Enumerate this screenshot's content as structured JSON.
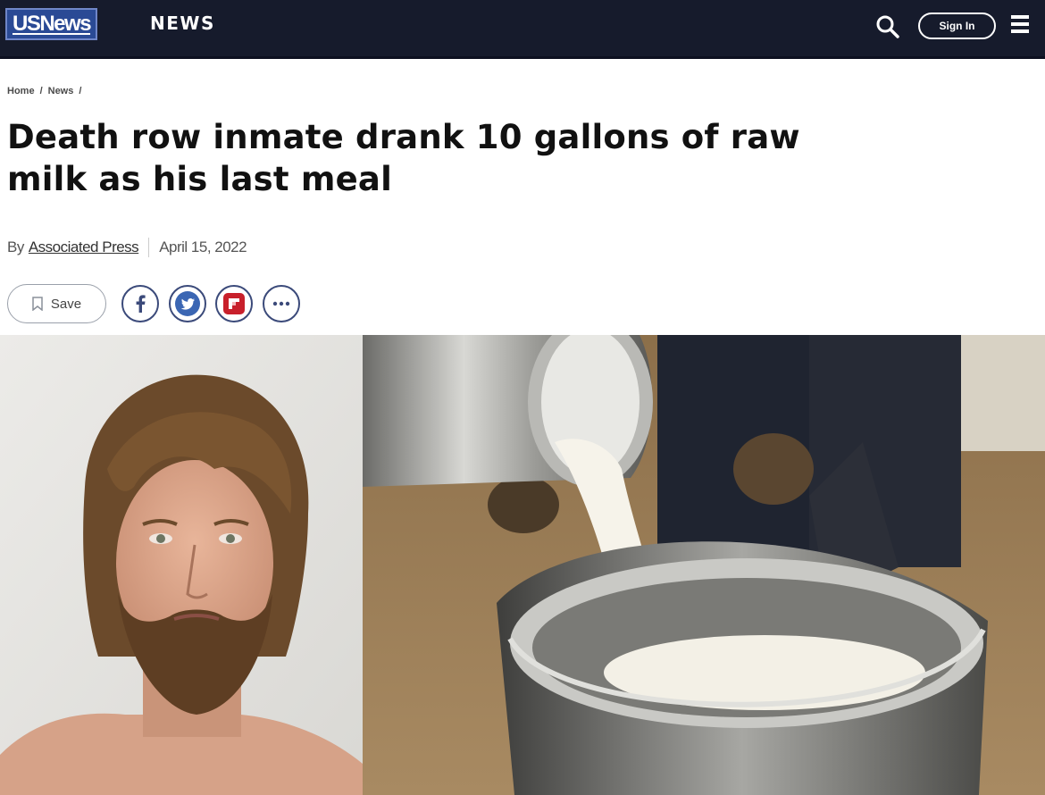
{
  "header": {
    "logo_text": "USNews",
    "section_label": "NEWS",
    "signin_label": "Sign In"
  },
  "breadcrumb": [
    "Home",
    "/",
    "News",
    "/"
  ],
  "article": {
    "headline": "Death row inmate drank 10 gallons of raw milk as his last meal",
    "byline_prefix": "By",
    "author": "Associated Press",
    "date": "April 15, 2022"
  },
  "share": {
    "save_label": "Save"
  },
  "colors": {
    "topbar": "#161b2c",
    "logo_bg": "#2a4a95",
    "pinterest": "#c8202b",
    "share_border": "#3b4a7a"
  },
  "images": {
    "left": "portrait-of-bearded-man",
    "right": "raw-milk-pouring-into-bucket"
  }
}
